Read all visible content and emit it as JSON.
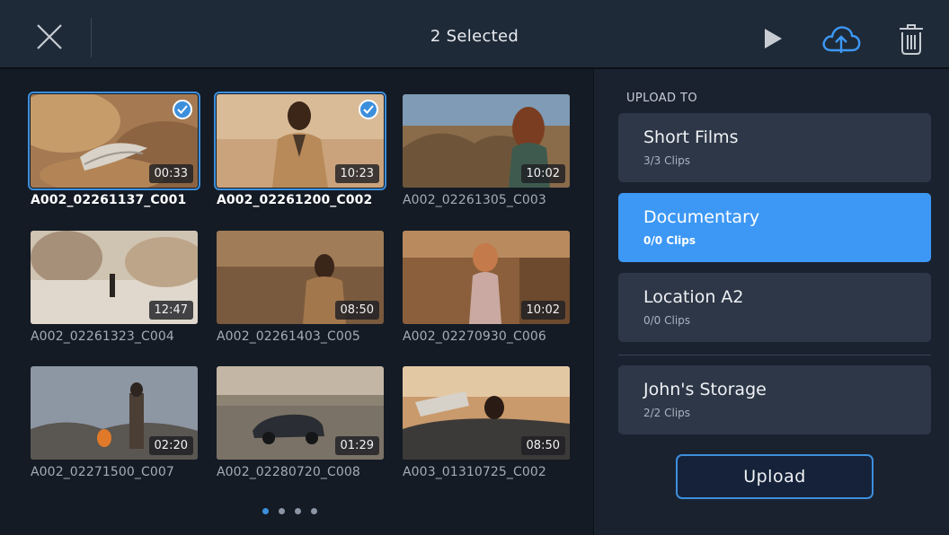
{
  "header": {
    "title": "2 Selected"
  },
  "clips": [
    {
      "name": "A002_02261137_C001",
      "duration": "00:33",
      "selected": true
    },
    {
      "name": "A002_02261200_C002",
      "duration": "10:23",
      "selected": true
    },
    {
      "name": "A002_02261305_C003",
      "duration": "10:02",
      "selected": false
    },
    {
      "name": "A002_02261323_C004",
      "duration": "12:47",
      "selected": false
    },
    {
      "name": "A002_02261403_C005",
      "duration": "08:50",
      "selected": false
    },
    {
      "name": "A002_02270930_C006",
      "duration": "10:02",
      "selected": false
    },
    {
      "name": "A002_02271500_C007",
      "duration": "02:20",
      "selected": false
    },
    {
      "name": "A002_02280720_C008",
      "duration": "01:29",
      "selected": false
    },
    {
      "name": "A003_01310725_C002",
      "duration": "08:50",
      "selected": false
    }
  ],
  "pager": {
    "pages": 4,
    "current": 1
  },
  "upload_panel": {
    "heading": "UPLOAD TO",
    "destinations": [
      {
        "name": "Short Films",
        "count": "3/3 Clips",
        "active": false
      },
      {
        "name": "Documentary",
        "count": "0/0 Clips",
        "active": true
      },
      {
        "name": "Location A2",
        "count": "0/0 Clips",
        "active": false
      },
      {
        "name": "John's Storage",
        "count": "2/2 Clips",
        "active": false
      }
    ],
    "upload_label": "Upload"
  },
  "colors": {
    "accent": "#3d98f5",
    "topbar": "#1f2a38",
    "panel": "#1a2230"
  },
  "icons": {
    "close": "close-icon",
    "play": "play-icon",
    "cloud_upload": "cloud-upload-icon",
    "trash": "trash-icon",
    "check": "checkmark-icon"
  }
}
